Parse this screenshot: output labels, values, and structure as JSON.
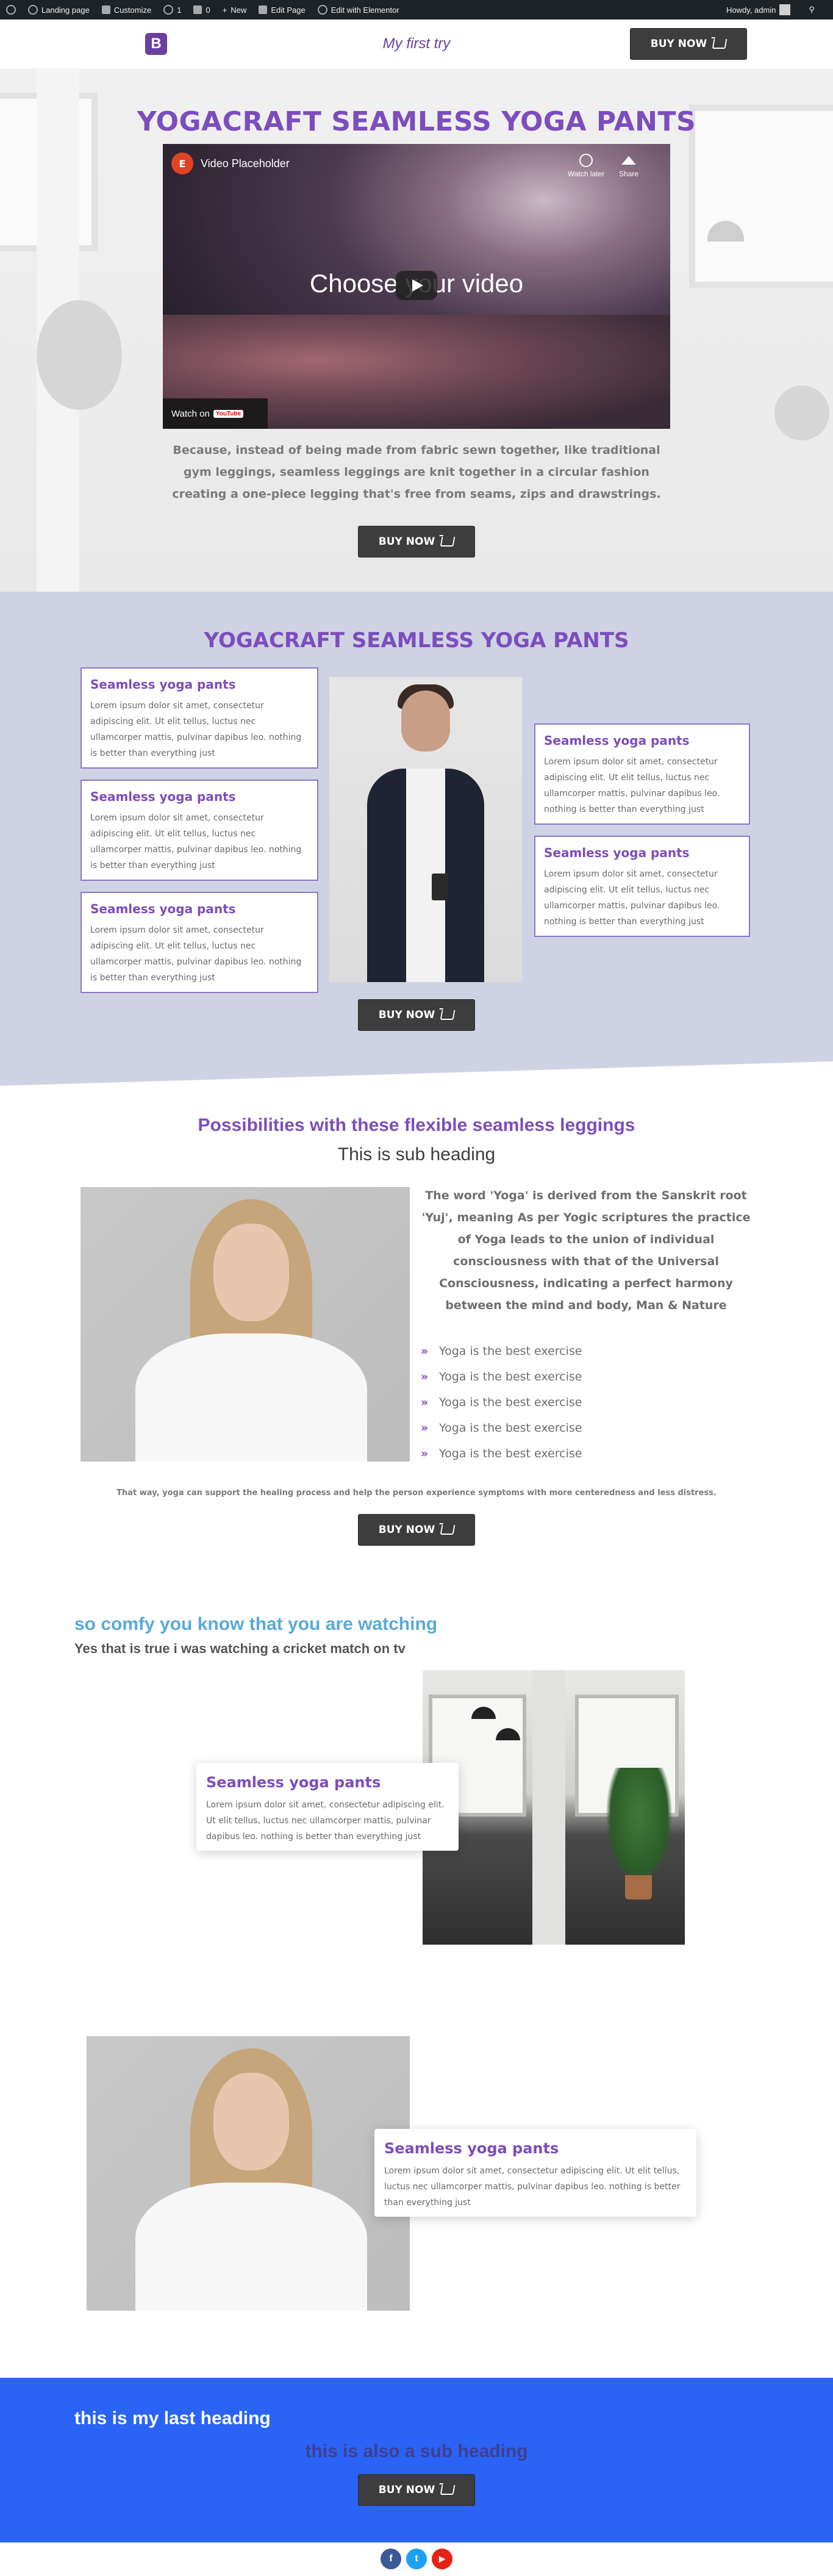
{
  "adminbar": {
    "items": [
      "Landing page",
      "Customize",
      "1",
      "0",
      "New",
      "Edit Page",
      "Edit with Elementor"
    ],
    "howdy": "Howdy, admin"
  },
  "header": {
    "logo": "B",
    "site_title": "My first try",
    "buy_label": "BUY NOW"
  },
  "hero": {
    "title": "YOGACRAFT SEAMLESS YOGA PANTS",
    "video": {
      "channel_logo": "E",
      "title": "Video Placeholder",
      "watch_later": "Watch later",
      "share": "Share",
      "overlay_text": "Choose your video",
      "watch_on": "Watch on",
      "youtube": "YouTube"
    },
    "text": "Because, instead of being made from fabric sewn together, like traditional gym leggings, seamless leggings are knit together in a circular fashion creating a one-piece legging that's free from seams, zips and drawstrings.",
    "buy_label": "BUY NOW"
  },
  "features": {
    "title": "YOGACRAFT SEAMLESS YOGA PANTS",
    "cards": [
      {
        "title": "Seamless yoga pants",
        "text": "Lorem ipsum dolor sit amet, consectetur adipiscing elit. Ut elit tellus, luctus nec ullamcorper mattis, pulvinar dapibus leo. nothing is better than everything just"
      },
      {
        "title": "Seamless yoga pants",
        "text": "Lorem ipsum dolor sit amet, consectetur adipiscing elit. Ut elit tellus, luctus nec ullamcorper mattis, pulvinar dapibus leo. nothing is better than everything just"
      },
      {
        "title": "Seamless yoga pants",
        "text": "Lorem ipsum dolor sit amet, consectetur adipiscing elit. Ut elit tellus, luctus nec ullamcorper mattis, pulvinar dapibus leo. nothing is better than everything just"
      },
      {
        "title": "Seamless yoga pants",
        "text": "Lorem ipsum dolor sit amet, consectetur adipiscing elit. Ut elit tellus, luctus nec ullamcorper mattis, pulvinar dapibus leo. nothing is better than everything just"
      },
      {
        "title": "Seamless yoga pants",
        "text": "Lorem ipsum dolor sit amet, consectetur adipiscing elit. Ut elit tellus, luctus nec ullamcorper mattis, pulvinar dapibus leo. nothing is better than everything just"
      }
    ],
    "buy_label": "BUY NOW"
  },
  "possibilities": {
    "title": "Possibilities with these flexible seamless leggings",
    "subtitle": "This is sub heading",
    "text": "The word 'Yoga' is derived from the Sanskrit root 'Yuj', meaning  As per Yogic scriptures the practice of Yoga leads to the union of individual consciousness with that of the Universal Consciousness, indicating a perfect harmony between the mind and body, Man & Nature",
    "bullets": [
      "Yoga is the best exercise",
      "Yoga is the best exercise",
      "Yoga is the best exercise",
      "Yoga is the best exercise",
      "Yoga is the best exercise"
    ],
    "small_text": "That way, yoga can support the healing process and help the person experience symptoms with more centeredness and less distress.",
    "buy_label": "BUY NOW"
  },
  "comfy": {
    "title": "so comfy you know that you are watching",
    "subtitle": "Yes that is true i was watching a cricket match on tv",
    "card": {
      "title": "Seamless yoga pants",
      "text": "Lorem ipsum dolor sit amet, consectetur adipiscing elit. Ut elit tellus, luctus nec ullamcorper mattis, pulvinar dapibus leo. nothing is better than everything just"
    }
  },
  "second": {
    "card": {
      "title": "Seamless yoga pants",
      "text": "Lorem ipsum dolor sit amet, consectetur adipiscing elit. Ut elit tellus, luctus nec ullamcorper mattis, pulvinar dapibus leo. nothing is better than everything just"
    }
  },
  "last": {
    "title": "this is my last heading",
    "subtitle": "this is also a sub heading",
    "buy_label": "BUY NOW"
  },
  "social": {
    "facebook": "f",
    "twitter": "t",
    "youtube": "▶"
  },
  "colors": {
    "accent": "#7c4dbd",
    "button": "#3d3d3d",
    "blue_section": "#2a63f5",
    "features_bg": "#cfd2e3",
    "comfy_title": "#5aa9d8"
  }
}
